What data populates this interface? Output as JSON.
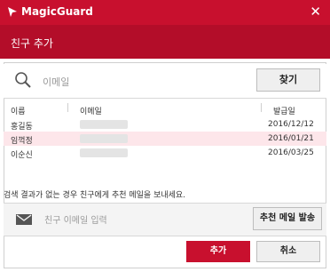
{
  "window": {
    "title": "MagicGuard",
    "close_glyph": "✕",
    "accent": "#c8102e"
  },
  "header": {
    "title": "친구 추가"
  },
  "search": {
    "placeholder": "이메일",
    "button_label": "찾기"
  },
  "table": {
    "headers": [
      "이름",
      "이메일",
      "발급일"
    ],
    "rows": [
      {
        "name": "홍길동",
        "email": "",
        "date": "2016/12/12",
        "selected": false
      },
      {
        "name": "임꺽정",
        "email": "",
        "date": "2016/01/21",
        "selected": true
      },
      {
        "name": "이순신",
        "email": "",
        "date": "2016/03/25",
        "selected": false
      }
    ]
  },
  "notice": "검색 결과가 없는 경우 친구에게 추천 메일을 보내세요.",
  "invite": {
    "placeholder": "친구 이메일 입력",
    "button_label": "추천 메일 발송"
  },
  "footer": {
    "add_label": "추가",
    "cancel_label": "취소"
  }
}
